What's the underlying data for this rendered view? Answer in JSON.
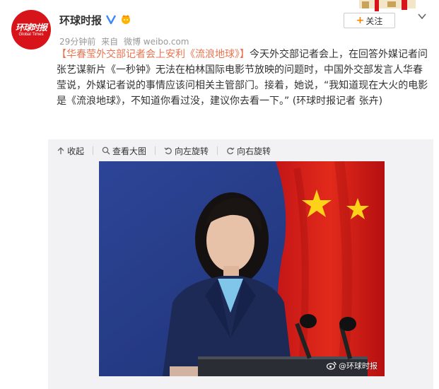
{
  "account": {
    "name": "环球时报",
    "avatar_logo_text": "环球时报",
    "avatar_logo_sub": "Global Times",
    "time": "29分钟前",
    "source_prefix": "来自",
    "source": "微博 weibo.com"
  },
  "follow_button": {
    "plus": "+",
    "label": "关注"
  },
  "post": {
    "tag_link": "【华春莹外交部记者会上安利《流浪地球》】",
    "body": "今天外交部记者会上，在回答外媒记者问张艺谋新片《一秒钟》无法在柏林国际电影节放映的问题时，中国外交部发言人华春莹说，外媒记者说的事情应该问相关主管部门。接着，她说，“我知道现在大火的电影是《流浪地球》，不知道你看过没，建议你去看一下。” (环球时报记者 张卉)"
  },
  "media_actions": [
    {
      "label": "收起",
      "icon": "collapse-icon"
    },
    {
      "label": "查看大图",
      "icon": "zoom-icon"
    },
    {
      "label": "向左旋转",
      "icon": "rotate-left-icon"
    },
    {
      "label": "向右旋转",
      "icon": "rotate-right-icon"
    }
  ],
  "watermark": "@环球时报",
  "colors": {
    "brand_red": "#d8141b",
    "link_orange": "#eb7350",
    "follow_plus": "#ff8200",
    "verify_blue": "#3b87f7"
  }
}
